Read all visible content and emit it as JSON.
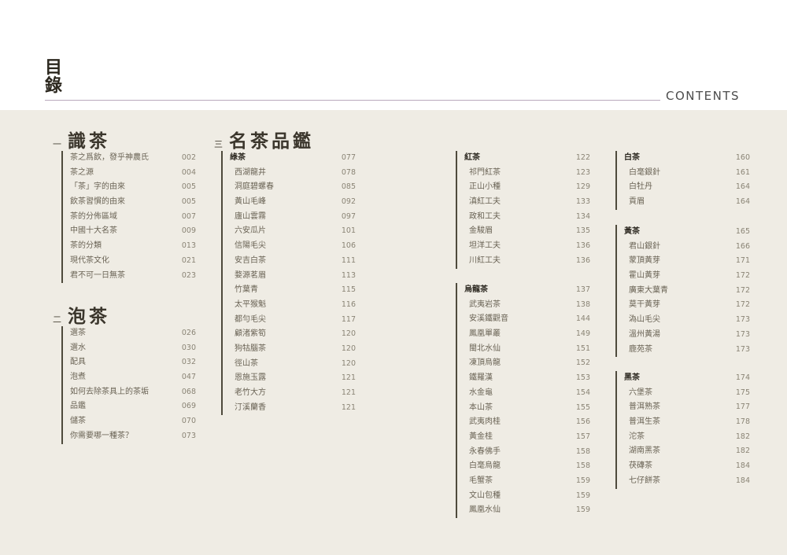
{
  "header": {
    "title_1": "目",
    "title_2": "錄",
    "contents": "CONTENTS"
  },
  "sections": [
    {
      "num": "一",
      "title": "識茶"
    },
    {
      "num": "二",
      "title": "泡茶"
    },
    {
      "num": "三",
      "title": "名茶品鑑"
    }
  ],
  "lists": {
    "know": [
      {
        "label": "茶之爲飲，發乎神農氏",
        "page": "002"
      },
      {
        "label": "茶之源",
        "page": "004"
      },
      {
        "label": "「茶」字的由來",
        "page": "005"
      },
      {
        "label": "飲茶習慣的由來",
        "page": "005"
      },
      {
        "label": "茶的分佈區域",
        "page": "007"
      },
      {
        "label": "中國十大名茶",
        "page": "009"
      },
      {
        "label": "茶的分類",
        "page": "013"
      },
      {
        "label": "現代茶文化",
        "page": "021"
      },
      {
        "label": "君不可一日無茶",
        "page": "023"
      }
    ],
    "brew": [
      {
        "label": "選茶",
        "page": "026"
      },
      {
        "label": "選水",
        "page": "030"
      },
      {
        "label": "配具",
        "page": "032"
      },
      {
        "label": "泡煮",
        "page": "047"
      },
      {
        "label": "如何去除茶具上的茶垢",
        "page": "068"
      },
      {
        "label": "品鑑",
        "page": "069"
      },
      {
        "label": "儲茶",
        "page": "070"
      },
      {
        "label": "你需要哪一種茶？",
        "page": "073"
      }
    ],
    "green": [
      {
        "label": "綠茶",
        "page": "077",
        "head": true
      },
      {
        "label": "西湖龍井",
        "page": "078"
      },
      {
        "label": "洞庭碧螺春",
        "page": "085"
      },
      {
        "label": "黃山毛峰",
        "page": "092"
      },
      {
        "label": "廬山雲霧",
        "page": "097"
      },
      {
        "label": "六安瓜片",
        "page": "101"
      },
      {
        "label": "信陽毛尖",
        "page": "106"
      },
      {
        "label": "安吉白茶",
        "page": "111"
      },
      {
        "label": "婺源茗眉",
        "page": "113"
      },
      {
        "label": "竹葉青",
        "page": "115"
      },
      {
        "label": "太平猴魁",
        "page": "116"
      },
      {
        "label": "都勻毛尖",
        "page": "117"
      },
      {
        "label": "顧渚紫筍",
        "page": "120"
      },
      {
        "label": "狗牯腦茶",
        "page": "120"
      },
      {
        "label": "徑山茶",
        "page": "120"
      },
      {
        "label": "恩施玉露",
        "page": "121"
      },
      {
        "label": "老竹大方",
        "page": "121"
      },
      {
        "label": "汀溪蘭香",
        "page": "121"
      }
    ],
    "red": [
      {
        "label": "紅茶",
        "page": "122",
        "head": true
      },
      {
        "label": "祁門紅茶",
        "page": "123"
      },
      {
        "label": "正山小種",
        "page": "129"
      },
      {
        "label": "滇紅工夫",
        "page": "133"
      },
      {
        "label": "政和工夫",
        "page": "134"
      },
      {
        "label": "金駿眉",
        "page": "135"
      },
      {
        "label": "坦洋工夫",
        "page": "136"
      },
      {
        "label": "川紅工夫",
        "page": "136"
      }
    ],
    "oolong": [
      {
        "label": "烏龍茶",
        "page": "137",
        "head": true
      },
      {
        "label": "武夷岩茶",
        "page": "138"
      },
      {
        "label": "安溪鐵觀音",
        "page": "144"
      },
      {
        "label": "鳳凰單叢",
        "page": "149"
      },
      {
        "label": "閩北水仙",
        "page": "151"
      },
      {
        "label": "凍頂烏龍",
        "page": "152"
      },
      {
        "label": "鐵羅漢",
        "page": "153"
      },
      {
        "label": "水金龜",
        "page": "154"
      },
      {
        "label": "本山茶",
        "page": "155"
      },
      {
        "label": "武夷肉桂",
        "page": "156"
      },
      {
        "label": "黃金桂",
        "page": "157"
      },
      {
        "label": "永春佛手",
        "page": "158"
      },
      {
        "label": "白毫烏龍",
        "page": "158"
      },
      {
        "label": "毛蟹茶",
        "page": "159"
      },
      {
        "label": "文山包種",
        "page": "159"
      },
      {
        "label": "鳳凰水仙",
        "page": "159"
      }
    ],
    "white": [
      {
        "label": "白茶",
        "page": "160",
        "head": true
      },
      {
        "label": "白毫銀針",
        "page": "161"
      },
      {
        "label": "白牡丹",
        "page": "164"
      },
      {
        "label": "貢眉",
        "page": "164"
      }
    ],
    "yellow": [
      {
        "label": "黃茶",
        "page": "165",
        "head": true
      },
      {
        "label": "君山銀針",
        "page": "166"
      },
      {
        "label": "蒙頂黃芽",
        "page": "171"
      },
      {
        "label": "霍山黃芽",
        "page": "172"
      },
      {
        "label": "廣東大葉青",
        "page": "172"
      },
      {
        "label": "莫干黃芽",
        "page": "172"
      },
      {
        "label": "溈山毛尖",
        "page": "173"
      },
      {
        "label": "溫州黃湯",
        "page": "173"
      },
      {
        "label": "鹿苑茶",
        "page": "173"
      }
    ],
    "dark": [
      {
        "label": "黑茶",
        "page": "174",
        "head": true
      },
      {
        "label": "六堡茶",
        "page": "175"
      },
      {
        "label": "普洱熟茶",
        "page": "177"
      },
      {
        "label": "普洱生茶",
        "page": "178"
      },
      {
        "label": "沱茶",
        "page": "182"
      },
      {
        "label": "湖南黑茶",
        "page": "182"
      },
      {
        "label": "茯磚茶",
        "page": "184"
      },
      {
        "label": "七仔餅茶",
        "page": "184"
      }
    ]
  }
}
